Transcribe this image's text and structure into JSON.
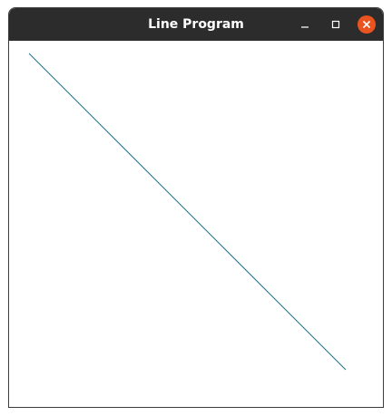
{
  "window": {
    "title": "Line Program"
  },
  "controls": {
    "minimize_icon": "minimize-icon",
    "maximize_icon": "maximize-icon",
    "close_icon": "close-icon",
    "close_color": "#e95420",
    "titlebar_color": "#2c2c2c"
  },
  "drawing": {
    "line_color": "#1f6f8b"
  }
}
